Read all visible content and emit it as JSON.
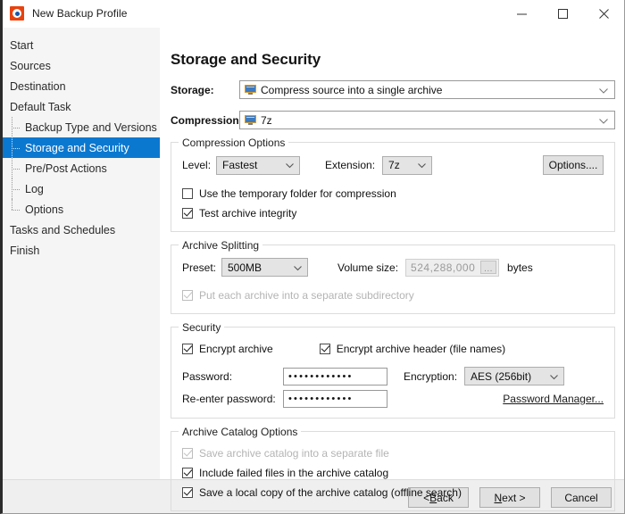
{
  "window": {
    "title": "New Backup Profile",
    "app_icon": "backup-app-icon",
    "controls": {
      "minimize": "minimize-icon",
      "maximize": "maximize-icon",
      "close": "close-icon"
    }
  },
  "sidebar": {
    "items": [
      {
        "label": "Start",
        "level": 0,
        "selected": false
      },
      {
        "label": "Sources",
        "level": 0,
        "selected": false
      },
      {
        "label": "Destination",
        "level": 0,
        "selected": false
      },
      {
        "label": "Default Task",
        "level": 0,
        "selected": false
      },
      {
        "label": "Backup Type and Versions",
        "level": 1,
        "selected": false
      },
      {
        "label": "Storage and Security",
        "level": 1,
        "selected": true
      },
      {
        "label": "Pre/Post Actions",
        "level": 1,
        "selected": false
      },
      {
        "label": "Log",
        "level": 1,
        "selected": false
      },
      {
        "label": "Options",
        "level": 1,
        "selected": false
      },
      {
        "label": "Tasks and Schedules",
        "level": 0,
        "selected": false
      },
      {
        "label": "Finish",
        "level": 0,
        "selected": false
      }
    ],
    "selected_color": "#0b78d0"
  },
  "main": {
    "page_title": "Storage and Security",
    "storage": {
      "label": "Storage:",
      "value": "Compress source into a single archive",
      "icon": "computer-monitor-icon"
    },
    "compression": {
      "label": "Compression:",
      "value": "7z",
      "icon": "computer-monitor-icon"
    },
    "compression_options": {
      "title": "Compression Options",
      "level_label": "Level:",
      "level_value": "Fastest",
      "extension_label": "Extension:",
      "extension_value": "7z",
      "options_button": "Options....",
      "temp_folder_checkbox": {
        "label": "Use the temporary folder for compression",
        "checked": false,
        "enabled": true
      },
      "test_integrity_checkbox": {
        "label": "Test archive integrity",
        "checked": true,
        "enabled": true
      }
    },
    "archive_splitting": {
      "title": "Archive Splitting",
      "preset_label": "Preset:",
      "preset_value": "500MB",
      "volume_size_label": "Volume size:",
      "volume_size_value": "524,288,000",
      "volume_browse_button": "...",
      "bytes_label": "bytes",
      "subdirectory_checkbox": {
        "label": "Put each archive into a separate subdirectory",
        "checked": true,
        "enabled": false
      }
    },
    "security": {
      "title": "Security",
      "encrypt_archive_checkbox": {
        "label": "Encrypt archive",
        "checked": true,
        "enabled": true
      },
      "encrypt_header_checkbox": {
        "label": "Encrypt archive header (file names)",
        "checked": true,
        "enabled": true
      },
      "password_label": "Password:",
      "password_value": "••••••••••••",
      "reenter_label": "Re-enter password:",
      "reenter_value": "••••••••••••",
      "encryption_label": "Encryption:",
      "encryption_value": "AES (256bit)",
      "password_manager_link": "Password Manager..."
    },
    "archive_catalog": {
      "title": "Archive Catalog Options",
      "separate_file_checkbox": {
        "label": "Save archive catalog into a separate file",
        "checked": true,
        "enabled": false
      },
      "failed_files_checkbox": {
        "label": "Include failed files in the archive catalog",
        "checked": true,
        "enabled": true
      },
      "local_copy_checkbox": {
        "label": "Save a local copy of the archive catalog (offline search)",
        "checked": true,
        "enabled": true
      }
    }
  },
  "footer": {
    "back_prefix": "< ",
    "back_accel": "B",
    "back_suffix": "ack",
    "next_accel": "N",
    "next_suffix": "ext >",
    "cancel": "Cancel"
  }
}
